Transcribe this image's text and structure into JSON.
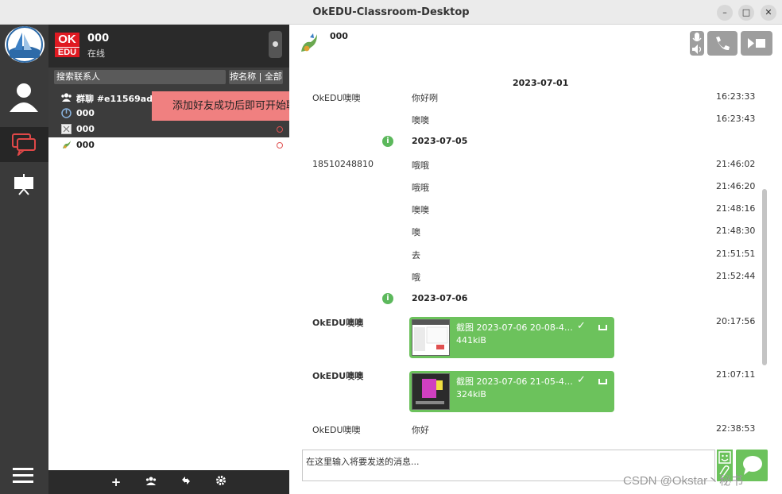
{
  "window": {
    "title": "OkEDU-Classroom-Desktop"
  },
  "user": {
    "logo_ok": "OK",
    "logo_edu": "EDU",
    "name": "000",
    "status": "在线"
  },
  "contacts": {
    "search_placeholder": "搜索联系人",
    "sort_label": "按名称 | 全部",
    "items": [
      {
        "label": "群聊 #e11569ad"
      },
      {
        "label": "000"
      },
      {
        "label": "000"
      },
      {
        "label": "000"
      }
    ]
  },
  "tooltip": {
    "text": "添加好友成功后即可开始聊天"
  },
  "chat": {
    "contact_name": "000",
    "dates": [
      "2023-07-01",
      "2023-07-05",
      "2023-07-06"
    ],
    "messages": [
      {
        "sender": "OkEDU噢噢",
        "text": "你好咧",
        "time": "16:23:33"
      },
      {
        "sender": "",
        "text": "噢噢",
        "time": "16:23:43"
      },
      {
        "sender": "18510248810",
        "text": "哦哦",
        "time": "21:46:02"
      },
      {
        "sender": "",
        "text": "哦哦",
        "time": "21:46:20"
      },
      {
        "sender": "",
        "text": "噢噢",
        "time": "21:48:16"
      },
      {
        "sender": "",
        "text": "噢",
        "time": "21:48:30"
      },
      {
        "sender": "",
        "text": "去",
        "time": "21:51:51"
      },
      {
        "sender": "",
        "text": "哦",
        "time": "21:52:44"
      },
      {
        "sender": "OkEDU噢噢",
        "file_name": "截图 2023-07-06 20-08-4…",
        "file_size": "441kiB",
        "time": "20:17:56"
      },
      {
        "sender": "OkEDU噢噢",
        "file_name": "截图 2023-07-06 21-05-4…",
        "file_size": "324kiB",
        "time": "21:07:11"
      },
      {
        "sender": "OkEDU噢噢",
        "text": "你好",
        "time": "22:38:53"
      }
    ],
    "input_placeholder": "在这里输入将要发送的消息..."
  },
  "watermark": "CSDN @Okstar丶秘书",
  "colors": {
    "accent_green": "#6cc25c",
    "brand_red": "#e01a22",
    "tooltip_bg": "#f08080"
  }
}
